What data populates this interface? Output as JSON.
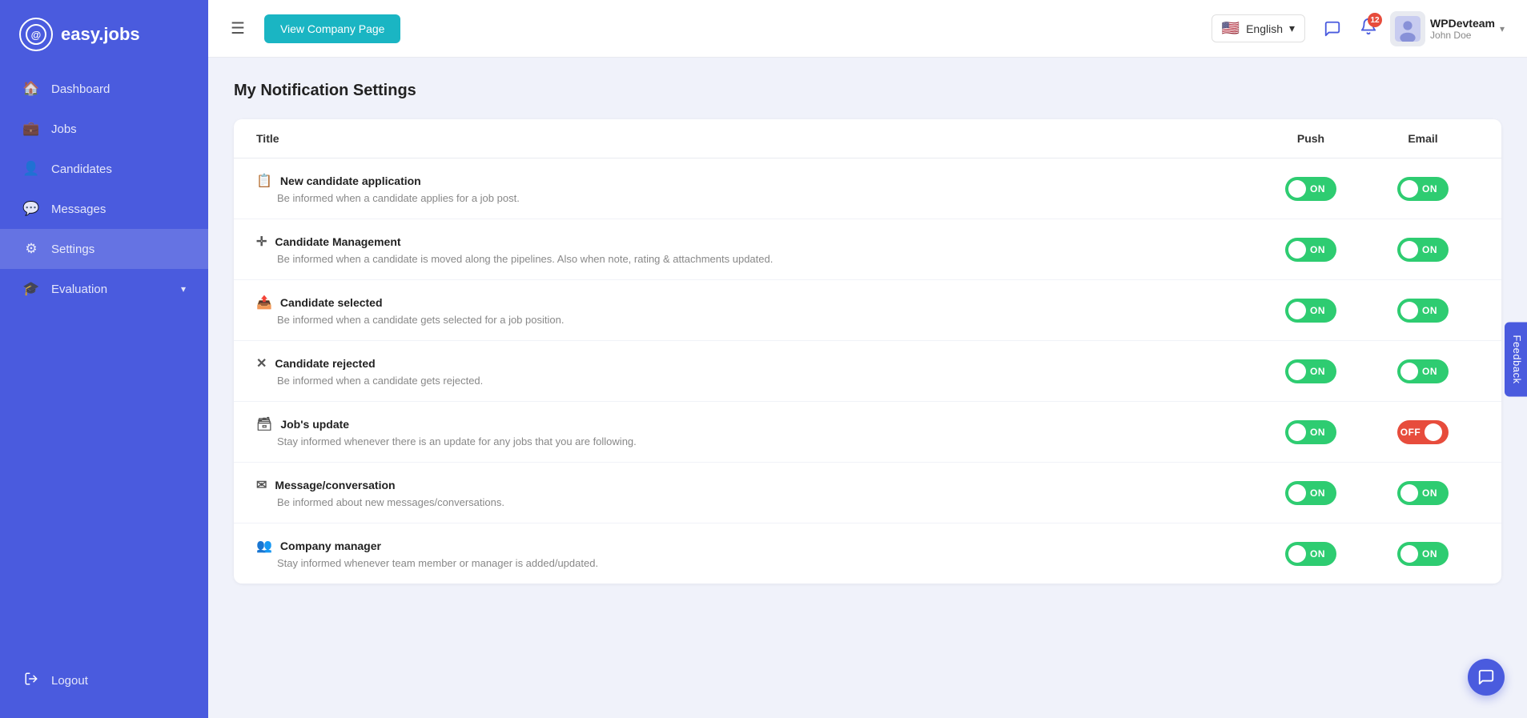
{
  "app": {
    "name": "easy.jobs",
    "logo_icon": "◎"
  },
  "sidebar": {
    "items": [
      {
        "id": "dashboard",
        "label": "Dashboard",
        "icon": "⌂",
        "active": false
      },
      {
        "id": "jobs",
        "label": "Jobs",
        "icon": "💼",
        "active": false
      },
      {
        "id": "candidates",
        "label": "Candidates",
        "icon": "👤",
        "active": false
      },
      {
        "id": "messages",
        "label": "Messages",
        "icon": "💬",
        "active": false
      },
      {
        "id": "settings",
        "label": "Settings",
        "icon": "⚙",
        "active": true
      },
      {
        "id": "evaluation",
        "label": "Evaluation",
        "icon": "🎓",
        "active": false,
        "hasArrow": true
      }
    ],
    "logout_label": "Logout",
    "logout_icon": "➜"
  },
  "header": {
    "menu_icon": "☰",
    "view_company_btn": "View Company Page",
    "language": {
      "label": "English",
      "flag": "🇺🇸"
    },
    "bell_count": "12",
    "user": {
      "name": "WPDevteam",
      "sub": "John Doe",
      "chevron": "▾"
    }
  },
  "page": {
    "title": "My Notification Settings",
    "columns": {
      "title": "Title",
      "push": "Push",
      "email": "Email"
    },
    "rows": [
      {
        "id": "new-candidate-application",
        "icon": "📋",
        "title": "New candidate application",
        "desc": "Be informed when a candidate applies for a job post.",
        "push": "on",
        "email": "on"
      },
      {
        "id": "candidate-management",
        "icon": "✛",
        "title": "Candidate Management",
        "desc": "Be informed when a candidate is moved along the pipelines. Also when note, rating & attachments updated.",
        "push": "on",
        "email": "on"
      },
      {
        "id": "candidate-selected",
        "icon": "📤",
        "title": "Candidate selected",
        "desc": "Be informed when a candidate gets selected for a job position.",
        "push": "on",
        "email": "on"
      },
      {
        "id": "candidate-rejected",
        "icon": "✕",
        "title": "Candidate rejected",
        "desc": "Be informed when a candidate gets rejected.",
        "push": "on",
        "email": "on"
      },
      {
        "id": "jobs-update",
        "icon": "🗃",
        "title": "Job's update",
        "desc": "Stay informed whenever there is an update for any jobs that you are following.",
        "push": "on",
        "email": "off"
      },
      {
        "id": "message-conversation",
        "icon": "✉",
        "title": "Message/conversation",
        "desc": "Be informed about new messages/conversations.",
        "push": "on",
        "email": "on"
      },
      {
        "id": "company-manager",
        "icon": "👥",
        "title": "Company manager",
        "desc": "Stay informed whenever team member or manager is added/updated.",
        "push": "on",
        "email": "on"
      }
    ]
  },
  "feedback": {
    "label": "Feedback"
  },
  "chat_bubble": {
    "icon": "💬"
  }
}
